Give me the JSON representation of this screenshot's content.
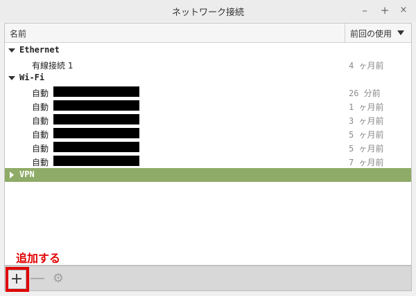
{
  "window": {
    "title": "ネットワーク接続",
    "controls": {
      "minimize": "–",
      "maximize": "+",
      "close": "×"
    }
  },
  "columns": {
    "name": "名前",
    "last_used": "前回の使用"
  },
  "groups": {
    "ethernet": {
      "label": "Ethernet",
      "items": [
        {
          "label": "有線接続 1",
          "time": "4 ヶ月前"
        }
      ]
    },
    "wifi": {
      "label": "Wi-Fi",
      "items": [
        {
          "label": "自動",
          "time": "26 分前"
        },
        {
          "label": "自動",
          "time": "1 ヶ月前"
        },
        {
          "label": "自動",
          "time": "3 ヶ月前"
        },
        {
          "label": "自動",
          "time": "5 ヶ月前"
        },
        {
          "label": "自動",
          "time": "5 ヶ月前"
        },
        {
          "label": "自動",
          "time": "7 ヶ月前"
        }
      ]
    },
    "vpn": {
      "label": "VPN",
      "selected": true
    }
  },
  "toolbar": {
    "add": "+",
    "remove": "—",
    "settings": "⚙"
  },
  "annotation": {
    "text": "追加する",
    "color": "#e00000"
  },
  "colors": {
    "selected_row": "#8fab68"
  }
}
